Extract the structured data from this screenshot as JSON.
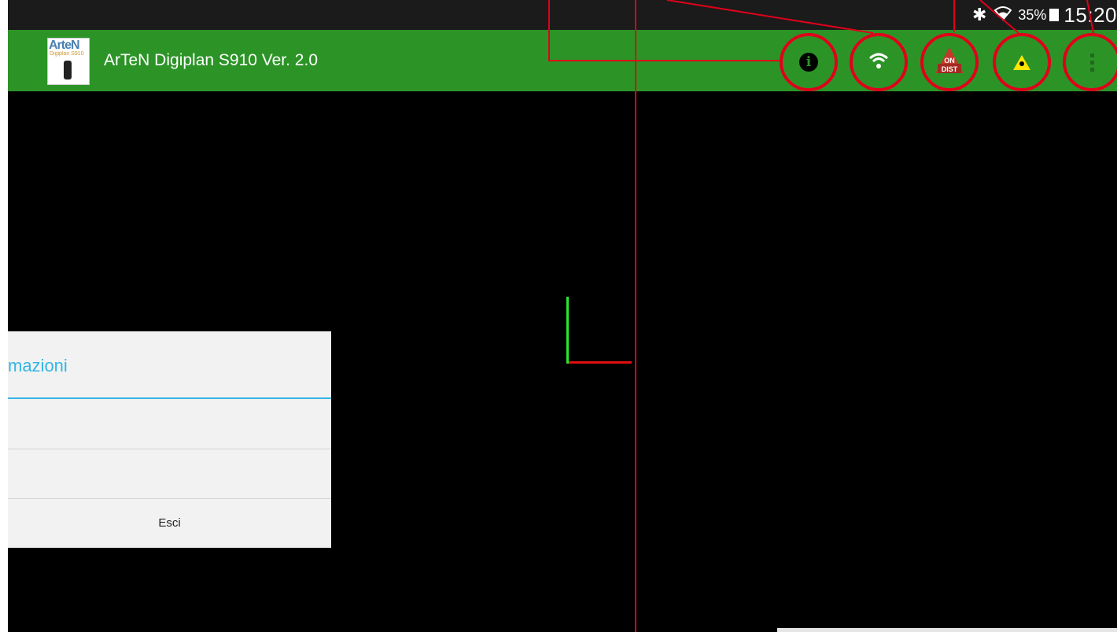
{
  "status_bar": {
    "battery_percent": "35%",
    "time": "15:20",
    "icons": [
      "bluetooth-icon",
      "wifi-icon",
      "battery-icon"
    ]
  },
  "action_bar": {
    "logo_text": "ArteN",
    "logo_subtext": "Digiplan S910",
    "title": "ArTeN Digiplan S910 Ver. 2.0",
    "buttons": [
      {
        "name": "info-icon",
        "glyph": "i"
      },
      {
        "name": "wifi-icon"
      },
      {
        "name": "on-dist-icon",
        "top": "ON",
        "bottom": "DIST"
      },
      {
        "name": "laser-warning-icon"
      },
      {
        "name": "overflow-menu-icon"
      }
    ],
    "color": "#2c9427"
  },
  "dialog": {
    "title": "mazioni",
    "exit_label": "Esci",
    "accent": "#33b5e5"
  },
  "axes": {
    "y_color": "#29e72a",
    "x_color": "#e01010"
  },
  "annotation_color": "#e0001a"
}
